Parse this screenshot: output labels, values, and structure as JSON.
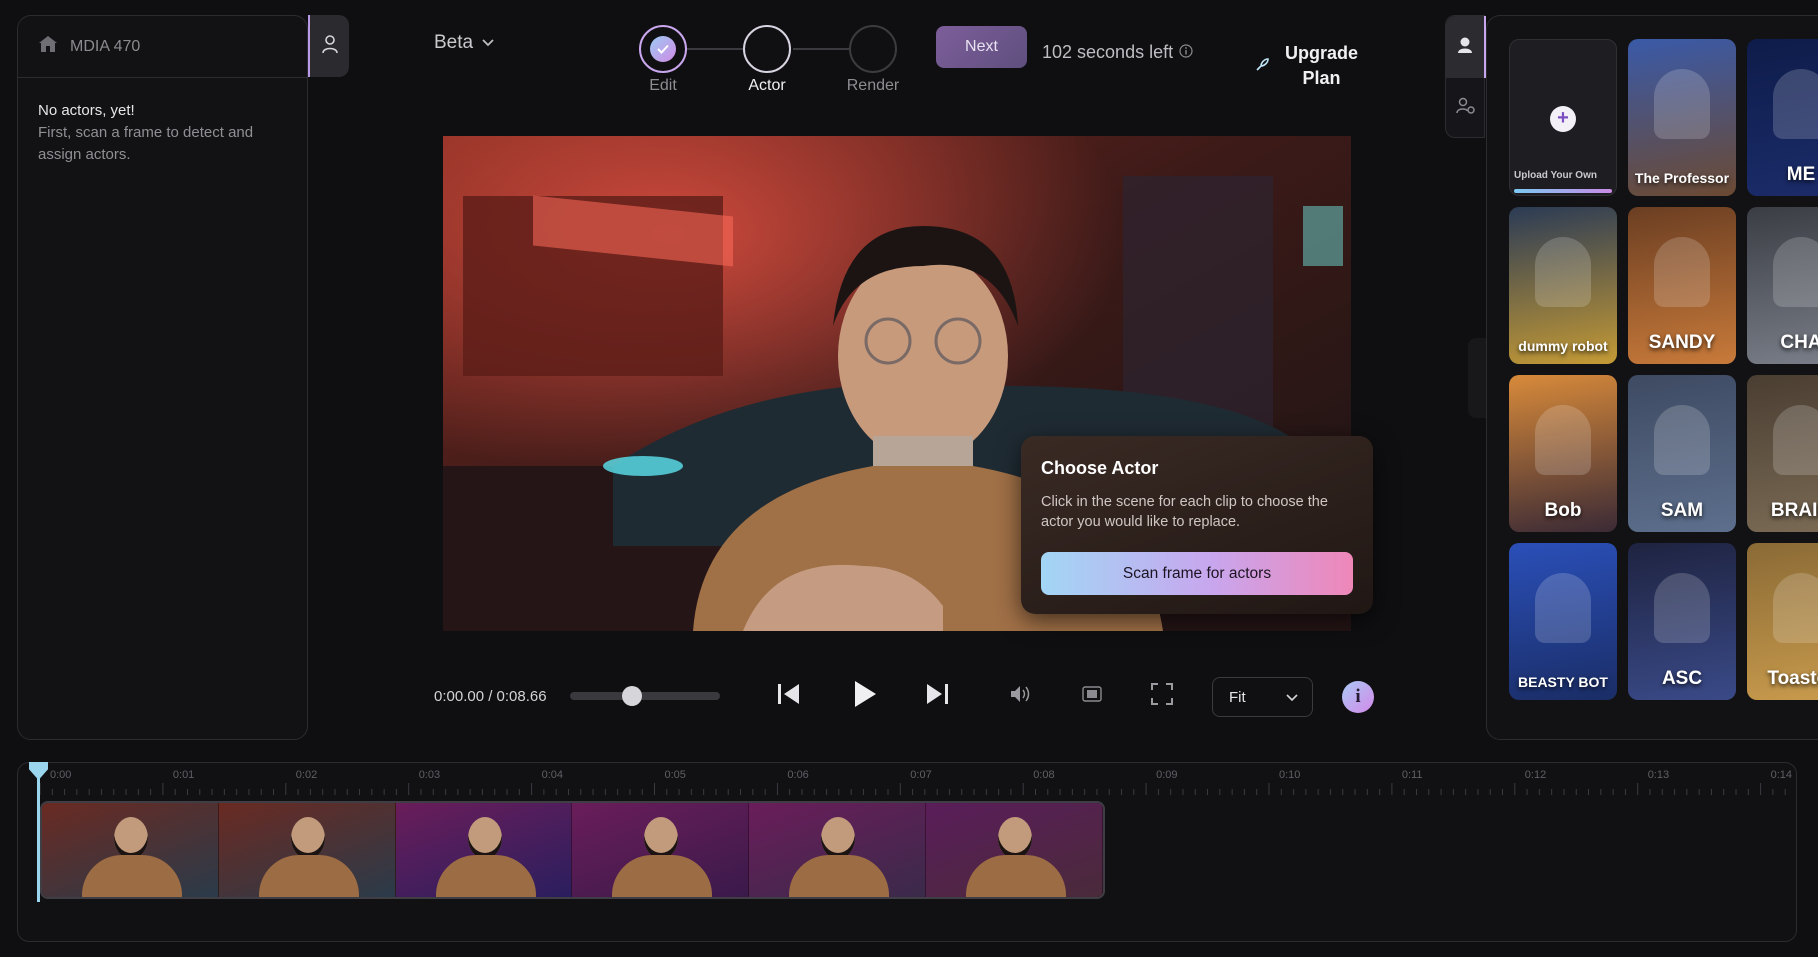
{
  "project": {
    "name": "MDIA 470"
  },
  "left_panel": {
    "empty_title": "No actors, yet!",
    "empty_desc": "First, scan a frame to detect and assign actors."
  },
  "header": {
    "version_label": "Beta",
    "steps": [
      {
        "label": "Edit",
        "state": "done"
      },
      {
        "label": "Actor",
        "state": "active"
      },
      {
        "label": "Render",
        "state": "pending"
      }
    ],
    "next_label": "Next",
    "time_left": "102 seconds left",
    "upgrade_line1": "Upgrade",
    "upgrade_line2": "Plan"
  },
  "actors": {
    "upload_label": "Upload Your Own",
    "items": [
      {
        "name": "The Professor",
        "colors": [
          "#3a5aa8",
          "#6b4a33"
        ]
      },
      {
        "name": "ME",
        "colors": [
          "#0e1c4a",
          "#1b2c6a"
        ]
      },
      {
        "name": "dummy robot",
        "colors": [
          "#2b3b55",
          "#c49a35"
        ]
      },
      {
        "name": "SANDY",
        "colors": [
          "#6b3e22",
          "#c87a3a"
        ]
      },
      {
        "name": "CHA",
        "colors": [
          "#3a3d44",
          "#7a7f89"
        ]
      },
      {
        "name": "Bob",
        "colors": [
          "#d88a3a",
          "#3b2a35"
        ]
      },
      {
        "name": "SAM",
        "colors": [
          "#3e4a62",
          "#5d6f8d"
        ]
      },
      {
        "name": "BRAIN",
        "colors": [
          "#4a3e32",
          "#7b6b55"
        ]
      },
      {
        "name": "BEASTY BOT",
        "colors": [
          "#2a4fb8",
          "#1a2d66"
        ]
      },
      {
        "name": "ASC",
        "colors": [
          "#1e2340",
          "#3a4a88"
        ]
      },
      {
        "name": "Toaster",
        "colors": [
          "#8a6a35",
          "#c99b4d"
        ]
      }
    ]
  },
  "popup": {
    "title": "Choose Actor",
    "desc": "Click in the scene for each clip to choose the actor you would like to replace.",
    "button": "Scan frame for actors"
  },
  "player": {
    "timecode": "0:00.00 / 0:08.66",
    "scrub_fraction": 0.4,
    "fit_label": "Fit"
  },
  "timeline": {
    "ticks": [
      "0:00",
      "0:01",
      "0:02",
      "0:03",
      "0:04",
      "0:05",
      "0:06",
      "0:07",
      "0:08",
      "0:09",
      "0:10",
      "0:11",
      "0:12",
      "0:13",
      "0:14"
    ],
    "clip_count": 6
  },
  "colors": {
    "accent": "#c9a7ee",
    "playhead": "#9ad7ee",
    "background": "#0f0f11"
  }
}
